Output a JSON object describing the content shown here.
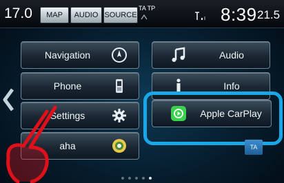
{
  "status_bar": {
    "temp_left": "17.0",
    "temp_right": "21.5",
    "buttons": {
      "map": "MAP",
      "audio": "AUDIO",
      "source": "SOURCE"
    },
    "ta_tp": "TA TP",
    "clock": "8:39"
  },
  "menu": {
    "left": [
      {
        "label": "Navigation",
        "icon": "compass-icon"
      },
      {
        "label": "Phone",
        "icon": "mobile-phone-icon"
      },
      {
        "label": "Settings",
        "icon": "gear-icon"
      },
      {
        "label": "aha",
        "icon": "aha-icon"
      }
    ],
    "right": [
      {
        "label": "Audio",
        "icon": "music-note-icon"
      },
      {
        "label": "Info",
        "icon": "info-icon"
      },
      {
        "label": "Apple CarPlay",
        "icon": "carplay-icon"
      }
    ]
  },
  "ta_button": "TA",
  "pagination": {
    "pages": 5,
    "active": 5
  },
  "colors": {
    "highlight": "#1aa7e8",
    "carplay_green": "#3bd14e",
    "hand_red": "#e0101a"
  }
}
